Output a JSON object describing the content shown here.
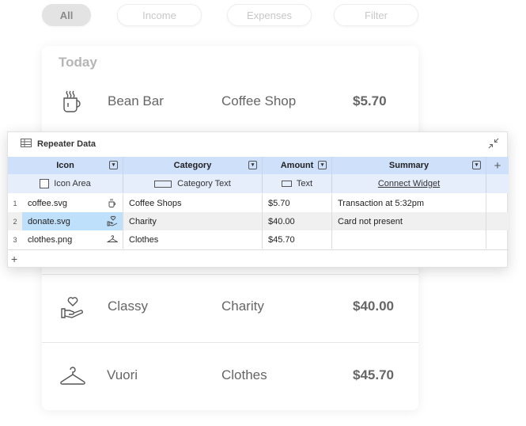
{
  "filters": {
    "items": [
      {
        "label": "All",
        "active": true
      },
      {
        "label": "Income",
        "active": false
      },
      {
        "label": "Expenses",
        "active": false
      },
      {
        "label": "Filter",
        "active": false
      }
    ]
  },
  "list": {
    "section_title": "Today",
    "transactions": [
      {
        "icon": "coffee-cup-icon",
        "name": "Bean Bar",
        "category": "Coffee Shop",
        "amount": "$5.70"
      },
      {
        "icon": "heart-hand-icon",
        "name": "Classy",
        "category": "Charity",
        "amount": "$40.00"
      },
      {
        "icon": "hanger-icon",
        "name": "Vuori",
        "category": "Clothes",
        "amount": "$45.70"
      }
    ]
  },
  "repeater": {
    "title": "Repeater Data",
    "columns": [
      {
        "label": "Icon",
        "sub": "Icon Area"
      },
      {
        "label": "Category",
        "sub": "Category Text"
      },
      {
        "label": "Amount",
        "sub": "Text"
      },
      {
        "label": "Summary",
        "sub": "Connect Widget"
      }
    ],
    "rows": [
      {
        "index": "1",
        "icon": "coffee.svg",
        "category": "Coffee Shops",
        "amount": "$5.70",
        "summary": "Transaction at 5:32pm"
      },
      {
        "index": "2",
        "icon": "donate.svg",
        "category": "Charity",
        "amount": "$40.00",
        "summary": "Card not present"
      },
      {
        "index": "3",
        "icon": "clothes.png",
        "category": "Clothes",
        "amount": "$45.70",
        "summary": ""
      }
    ],
    "add_column_label": "+",
    "add_row_label": "+"
  },
  "colors": {
    "header_blue": "#cfe0fb",
    "subheader_blue": "#e6eefc",
    "selected_cell": "#bfe0fb"
  }
}
